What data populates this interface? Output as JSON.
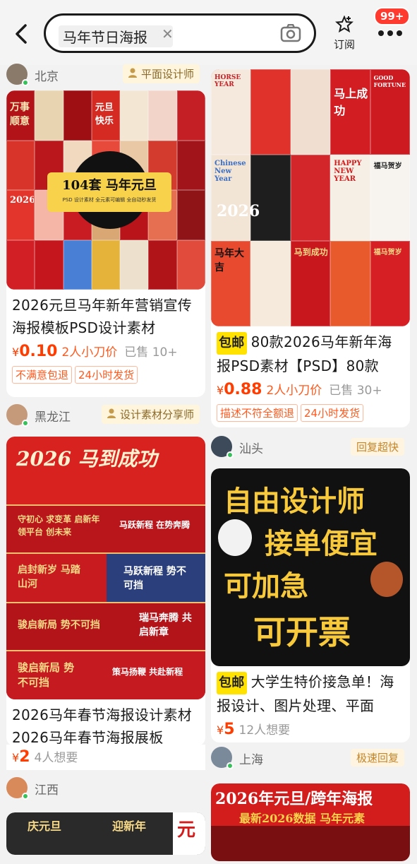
{
  "search": {
    "query": "马年节日海报"
  },
  "header": {
    "subscribe_label": "订阅",
    "badge": "99+"
  },
  "colors": {
    "accent": "#ff3d00",
    "baoyou": "#ffe200",
    "red": "#d31d1d"
  },
  "left": {
    "seller_top": {
      "location": "北京",
      "tag": "平面设计师"
    },
    "card1": {
      "image_text": {
        "count": "104套 马年元旦",
        "sub": "PSD 设计素材   全元素可编辑  全自动秒发货",
        "year_text": "万事顺意",
        "yuan": "元旦快乐",
        "tile_a": "2026"
      },
      "title": "2026元旦马年新年营销宣传海报模板PSD设计素材",
      "price": "0.10",
      "note": "2人小刀价",
      "sold": "已售 10+",
      "tags": [
        "不满意包退",
        "24小时发货"
      ]
    },
    "seller2": {
      "location": "黑龙江",
      "tag": "设计素材分享师"
    },
    "card2": {
      "image_text": {
        "headline": "2026 马到成功",
        "b1": "守初心 求变革 启新年 领平台 创未来",
        "b2": "马跃新程 在势奔腾",
        "b3": "启封新岁 马踏山河",
        "b4": "马跃新程 势不可挡",
        "b5": "骏启新局 势不可挡",
        "b6": "瑞马奔腾 共启新章",
        "b7": "骏启新局 势不可挡",
        "b8": "策马扬鞭 共赴新程"
      },
      "title": "2026马年春节海报设计素材 2026马年春节海报展板",
      "price": "2",
      "wants": "4人想要"
    },
    "seller3": {
      "location": "江西"
    },
    "card3": {
      "image_text": {
        "a": "庆元旦",
        "b": "迎新年",
        "c": "元"
      }
    }
  },
  "right": {
    "card1": {
      "image_text": {
        "horse_year": "HORSE YEAR",
        "t1": "马上成功",
        "t2": "GOOD FORTUNE",
        "t3": "Chinese New Year",
        "t4": "HAPPY NEW YEAR",
        "t5": "2026",
        "t6": "福马贺岁",
        "t7": "马年大吉",
        "t8": "马到成功",
        "t9": "福马贺岁"
      },
      "badge": "包邮",
      "title": "80款2026马年新年海报PSD素材【PSD】80款",
      "price": "0.88",
      "note": "2人小刀价",
      "sold": "已售 30+",
      "tags": [
        "描述不符全额退",
        "24小时发货"
      ]
    },
    "seller2": {
      "location": "汕头",
      "reply": "回复超快"
    },
    "card2": {
      "image_text": {
        "l1": "自由设计师",
        "l2": "接单便宜",
        "l3": "可加急",
        "l4": "可开票"
      },
      "badge": "包邮",
      "title": "大学生特价接急单！海报设计、图片处理、平面",
      "price": "5",
      "wants": "12人想要"
    },
    "seller3": {
      "location": "上海",
      "reply": "极速回复"
    },
    "card3": {
      "image_text": {
        "headline": "2026年元旦/跨年海报",
        "sub": "最新2026数据  马年元素"
      }
    }
  }
}
